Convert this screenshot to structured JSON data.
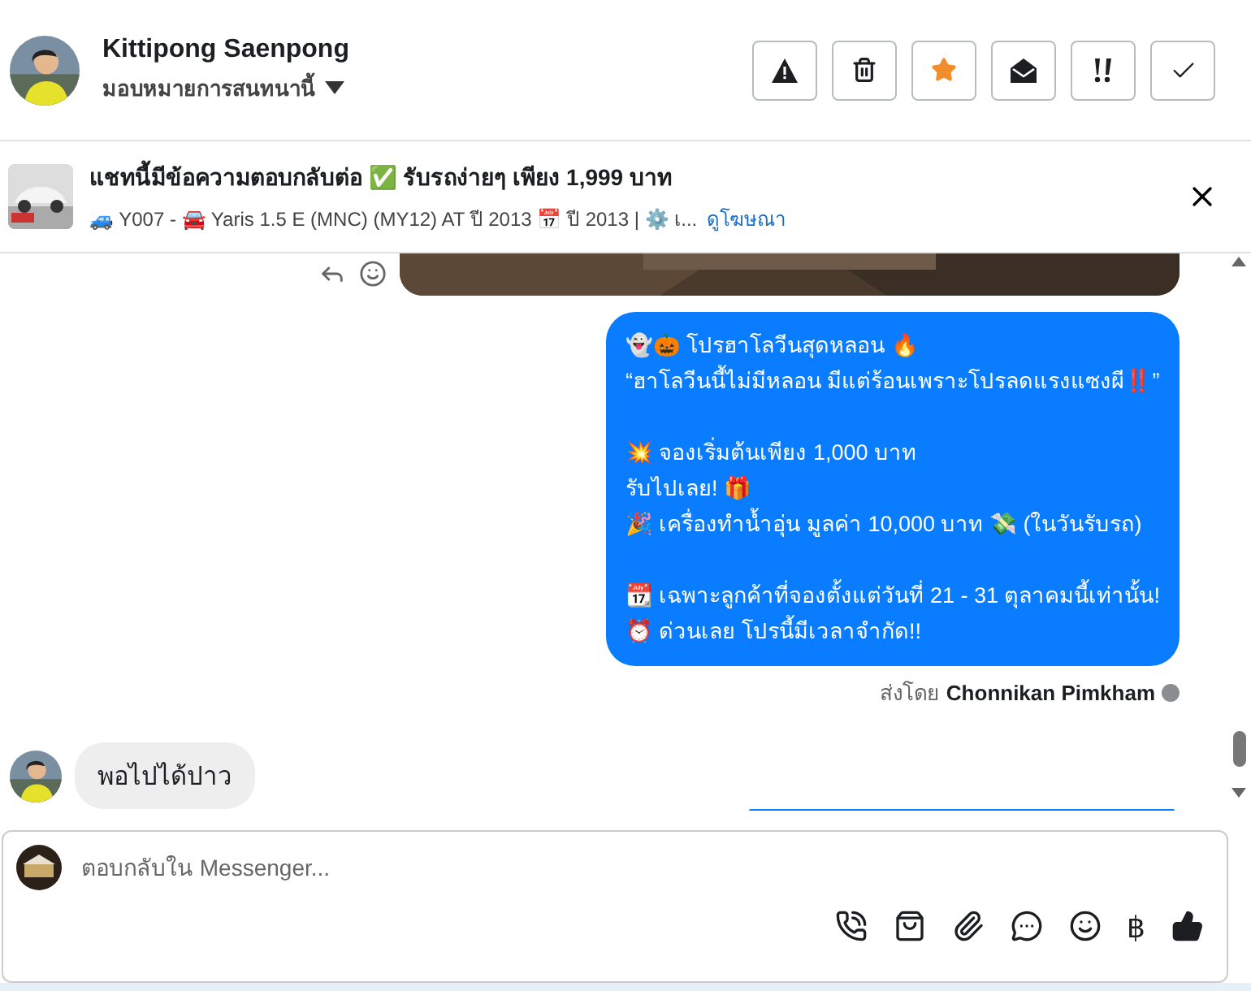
{
  "header": {
    "name": "Kittipong Saenpong",
    "assign": "มอบหมายการสนทนานี้",
    "actions": [
      {
        "kind": "spam"
      },
      {
        "kind": "delete"
      },
      {
        "kind": "star",
        "starred": true
      },
      {
        "kind": "unread"
      },
      {
        "kind": "important"
      },
      {
        "kind": "done"
      }
    ]
  },
  "ad": {
    "title": "แชทนี้มีข้อความตอบกลับต่อ ✅ รับรถง่ายๆ เพียง 1,999 บาท",
    "details": "🚙 Y007 - 🚘 Yaris 1.5 E (MNC) (MY12) AT ปี 2013 📅 ปี 2013 | ⚙️ เ...",
    "link": "ดูโฆษณา"
  },
  "messages": [
    {
      "kind": "picture"
    },
    {
      "kind": "outgoing",
      "paragraphs": [
        "👻🎃 โปรฮาโลวีนสุดหลอน 🔥\n“ฮาโลวีนนี้ไม่มีหลอน มีแต่ร้อนเพราะโปรลดแรงแซงผี‼️”",
        "💥 จองเริ่มต้นเพียง 1,000 บาท\nรับไปเลย! 🎁\n🎉 เครื่องทำน้ำอุ่น มูลค่า 10,000 บาท 💸 (ในวันรับรถ)",
        "📆 เฉพาะลูกค้าที่จองตั้งแต่วันที่ 21 - 31 ตุลาคมนี้เท่านั้น!\n⏰ ด่วนเลย โปรนี้มีเวลาจำกัด!!"
      ],
      "sent_by_label": "ส่งโดย",
      "sent_by": "Chonnikan Pimkham"
    },
    {
      "kind": "incoming",
      "text": "พอไปได้ปาว"
    },
    {
      "kind": "outgoing_cut"
    }
  ],
  "composer": {
    "placeholder": "ตอบกลับใน Messenger...",
    "baht": "฿"
  }
}
